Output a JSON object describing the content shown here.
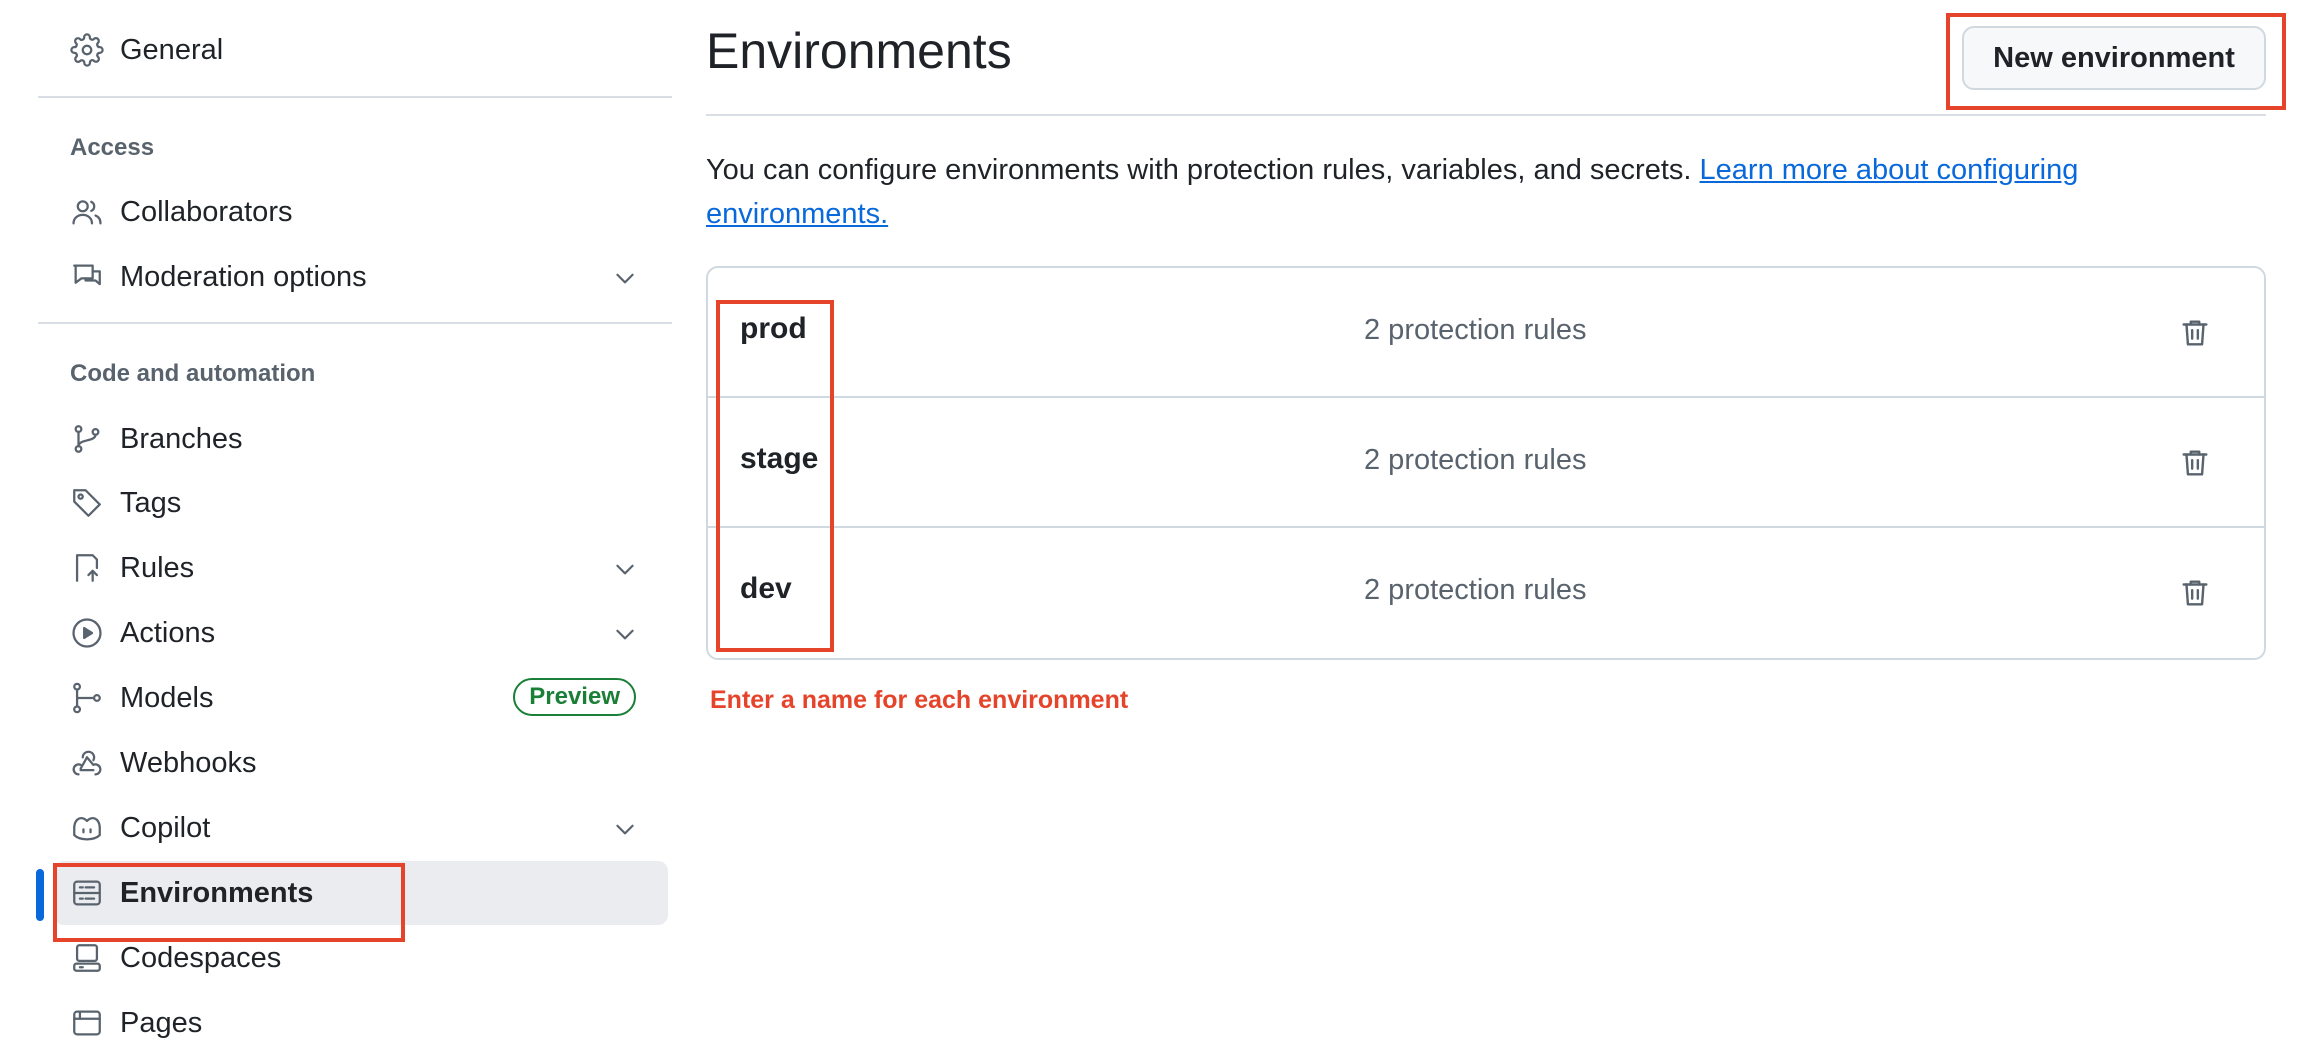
{
  "sidebar": {
    "general": {
      "label": "General",
      "icon": "gear-icon"
    },
    "access_heading": "Access",
    "access_items": [
      {
        "label": "Collaborators",
        "icon": "people-icon"
      },
      {
        "label": "Moderation options",
        "icon": "report-icon",
        "expandable": true
      }
    ],
    "code_heading": "Code and automation",
    "code_items": [
      {
        "label": "Branches",
        "icon": "git-branch-icon"
      },
      {
        "label": "Tags",
        "icon": "tag-icon"
      },
      {
        "label": "Rules",
        "icon": "rules-icon",
        "expandable": true
      },
      {
        "label": "Actions",
        "icon": "play-icon",
        "expandable": true
      },
      {
        "label": "Models",
        "icon": "models-icon",
        "badge": "Preview"
      },
      {
        "label": "Webhooks",
        "icon": "webhook-icon"
      },
      {
        "label": "Copilot",
        "icon": "copilot-icon",
        "expandable": true
      },
      {
        "label": "Environments",
        "icon": "server-icon",
        "active": true
      },
      {
        "label": "Codespaces",
        "icon": "codespaces-icon"
      },
      {
        "label": "Pages",
        "icon": "browser-icon"
      }
    ]
  },
  "main": {
    "title": "Environments",
    "new_button": "New environment",
    "description": "You can configure environments with protection rules, variables, and secrets. ",
    "learn_more": "Learn more about configuring environments.",
    "environments": [
      {
        "name": "prod",
        "rules": "2 protection rules"
      },
      {
        "name": "stage",
        "rules": "2 protection rules"
      },
      {
        "name": "dev",
        "rules": "2 protection rules"
      }
    ]
  },
  "annotation": {
    "note": "Enter a name for each environment",
    "color": "#e5432a"
  },
  "colors": {
    "accent": "#0969da",
    "badge_green": "#1a7f37",
    "active_bg": "#eaecef"
  }
}
